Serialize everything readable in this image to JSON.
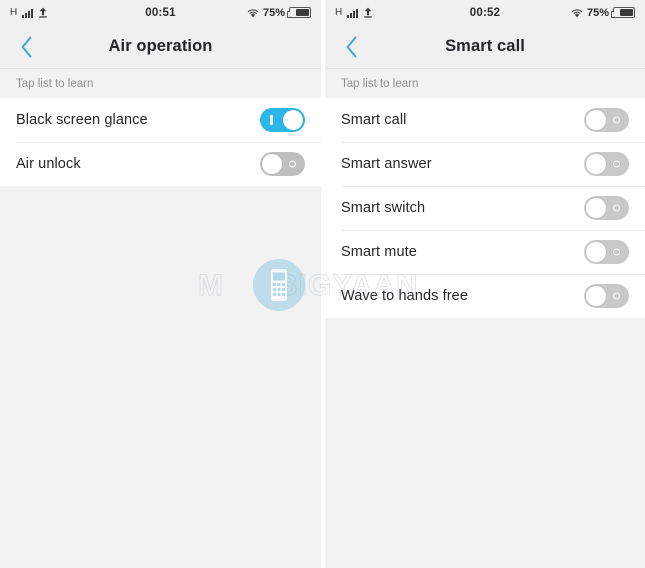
{
  "theme": {
    "accent_blue": "#2cb6e8",
    "chevron_blue": "#3aa8cc",
    "toggle_off_gray": "#bfbfbf",
    "header_bg": "#f0f0f0",
    "page_bg": "#f2f2f2",
    "row_bg": "#ffffff",
    "text_primary": "#262626",
    "text_muted": "#8e8e8e"
  },
  "watermark": {
    "text_before": "M",
    "text_after": "BIGYAAN",
    "logo_icon": "mobile-phone-icon"
  },
  "screens": [
    {
      "id": "air-operation",
      "status_bar": {
        "network_label": "H",
        "signal_icon": "signal-bars-icon",
        "upload_icon": "upload-arrow-icon",
        "time": "00:51",
        "wifi_icon": "wifi-icon",
        "battery_percent": "75%",
        "battery_icon": "battery-icon",
        "battery_level": 75
      },
      "header": {
        "back_icon": "chevron-left-icon",
        "title": "Air operation"
      },
      "hint": "Tap list to learn",
      "rows": [
        {
          "label": "Black screen glance",
          "toggle": "on"
        },
        {
          "label": "Air unlock",
          "toggle": "off"
        }
      ]
    },
    {
      "id": "smart-call",
      "status_bar": {
        "network_label": "H",
        "signal_icon": "signal-bars-icon",
        "upload_icon": "upload-arrow-icon",
        "time": "00:52",
        "wifi_icon": "wifi-icon",
        "battery_percent": "75%",
        "battery_icon": "battery-icon",
        "battery_level": 75
      },
      "header": {
        "back_icon": "chevron-left-icon",
        "title": "Smart call"
      },
      "hint": "Tap list to learn",
      "rows": [
        {
          "label": "Smart call",
          "toggle": "off"
        },
        {
          "label": "Smart answer",
          "toggle": "off"
        },
        {
          "label": "Smart switch",
          "toggle": "off"
        },
        {
          "label": "Smart mute",
          "toggle": "off"
        },
        {
          "label": "Wave to hands free",
          "toggle": "off"
        }
      ]
    }
  ]
}
